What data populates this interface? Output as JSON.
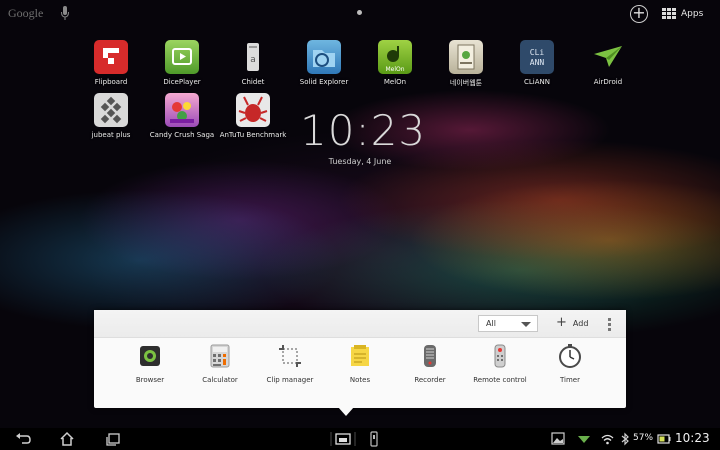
{
  "top_bar": {
    "search_label": "Google",
    "apps_label": "Apps"
  },
  "desktop": {
    "apps": [
      {
        "label": "Flipboard",
        "icon": "flipboard-icon"
      },
      {
        "label": "DicePlayer",
        "icon": "diceplayer-icon"
      },
      {
        "label": "Chidet",
        "icon": "chidet-icon"
      },
      {
        "label": "Solid Explorer",
        "icon": "solid-explorer-icon"
      },
      {
        "label": "MelOn",
        "icon": "melon-icon"
      },
      {
        "label": "네이버웹툰",
        "icon": "naver-webtoon-icon"
      },
      {
        "label": "CLiANN",
        "icon": "cliann-icon"
      },
      {
        "label": "AirDroid",
        "icon": "airdroid-icon"
      },
      {
        "label": "jubeat plus",
        "icon": "jubeat-icon"
      },
      {
        "label": "Candy Crush Saga",
        "icon": "candy-crush-icon"
      },
      {
        "label": "AnTuTu Benchmark",
        "icon": "antutu-icon"
      }
    ],
    "clock_time": "10:23",
    "clock_date": "Tuesday, 4 June"
  },
  "small_apps": {
    "filter_value": "All",
    "add_label": "Add",
    "items": [
      {
        "label": "Browser",
        "icon": "browser-icon"
      },
      {
        "label": "Calculator",
        "icon": "calculator-icon"
      },
      {
        "label": "Clip manager",
        "icon": "clip-manager-icon"
      },
      {
        "label": "Notes",
        "icon": "notes-icon"
      },
      {
        "label": "Recorder",
        "icon": "recorder-icon"
      },
      {
        "label": "Remote control",
        "icon": "remote-control-icon"
      },
      {
        "label": "Timer",
        "icon": "timer-icon"
      }
    ]
  },
  "status_bar": {
    "battery_percent": "57%",
    "time": "10:23"
  },
  "colors": {
    "panel_background": "#fafafa",
    "clock_text": "#d9d9d9",
    "wallpaper_base": "#07050b"
  }
}
